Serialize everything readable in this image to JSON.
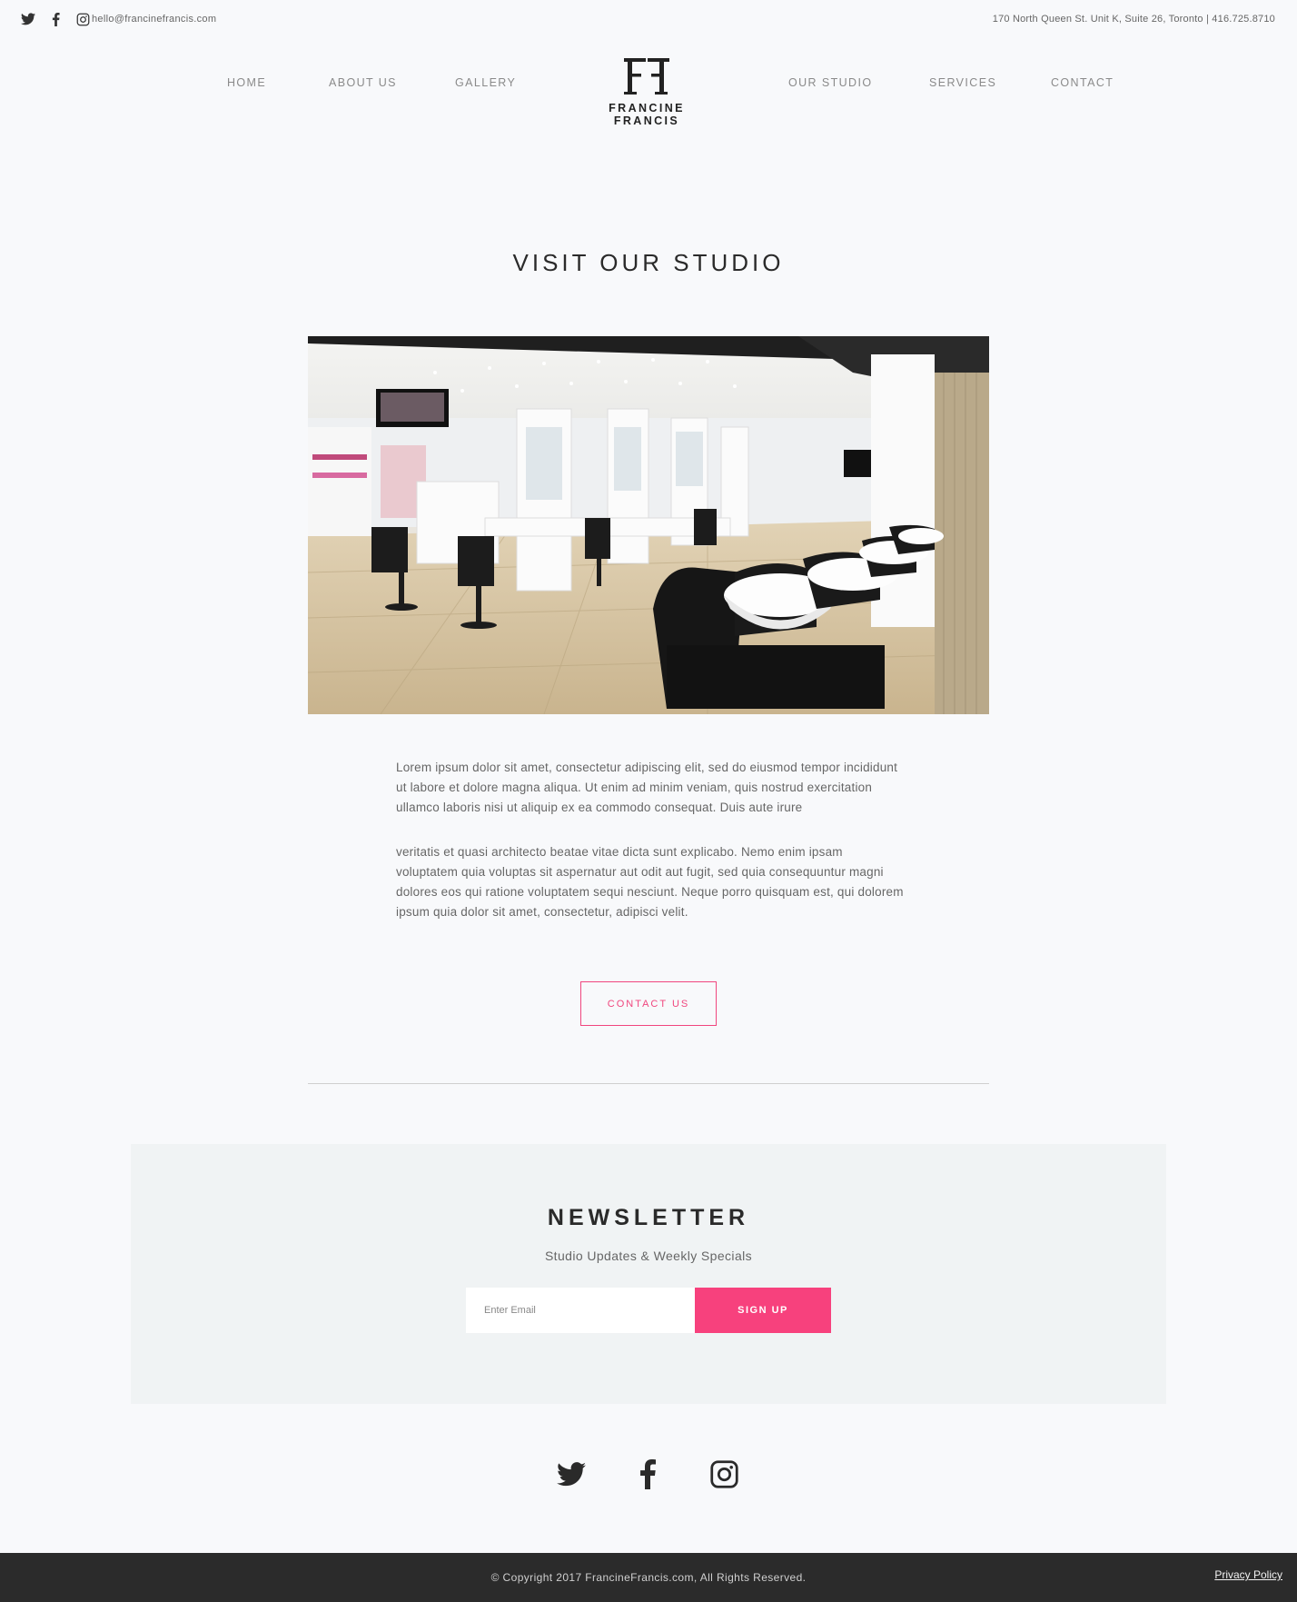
{
  "topbar": {
    "icons": [
      "twitter-icon",
      "facebook-icon",
      "instagram-icon"
    ],
    "email": "hello@francinefrancis.com",
    "address": "170 North Queen St. Unit K, Suite 26, Toronto | 416.725.8710"
  },
  "nav": {
    "left": [
      "HOME",
      "ABOUT US",
      "GALLERY"
    ],
    "right": [
      "OUR STUDIO",
      "SERVICES",
      "CONTACT"
    ],
    "logo_text": "FRANCINE FRANCIS",
    "logo_mark": "FF"
  },
  "studio": {
    "title": "VISIT OUR STUDIO",
    "paragraph1": "Lorem ipsum dolor sit amet, consectetur adipiscing elit, sed do eiusmod tempor incididunt ut labore et dolore magna aliqua. Ut enim ad minim veniam, quis nostrud exercitation ullamco laboris nisi ut aliquip ex ea commodo consequat. Duis aute irure",
    "paragraph2": "veritatis et quasi architecto beatae vitae dicta sunt explicabo. Nemo enim ipsam voluptatem quia voluptas sit aspernatur aut odit aut fugit, sed quia consequuntur magni dolores eos qui ratione voluptatem sequi nesciunt. Neque porro quisquam est, qui dolorem ipsum quia dolor sit amet, consectetur, adipisci velit.",
    "cta_label": "CONTACT US"
  },
  "newsletter": {
    "title": "NEWSLETTER",
    "subtitle": "Studio Updates & Weekly Specials",
    "placeholder": "Enter Email",
    "button_label": "SIGN UP"
  },
  "footer": {
    "social_icons": [
      "twitter-icon",
      "facebook-icon",
      "instagram-icon"
    ],
    "copyright": "© Copyright 2017 FrancineFrancis.com, All Rights Reserved.",
    "privacy_label": "Privacy Policy"
  },
  "colors": {
    "accent": "#f7417d",
    "background": "#f8f9fb",
    "footer_bg": "#2b2b2b",
    "newsletter_bg": "#f0f3f4"
  }
}
